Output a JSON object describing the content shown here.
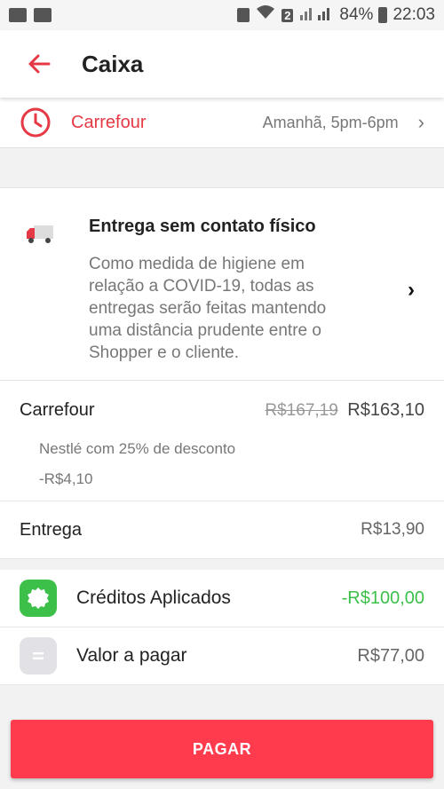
{
  "status_bar": {
    "battery": "84%",
    "time": "22:03",
    "sim_badge": "2"
  },
  "appbar": {
    "title": "Caixa"
  },
  "slot": {
    "store": "Carrefour",
    "time": "Amanhã, 5pm-6pm"
  },
  "contact": {
    "title": "Entrega sem contato físico",
    "description": "Como medida de higiene em relação a COVID-19, todas as entregas serão feitas mantendo uma distância prudente entre o Shopper e o cliente."
  },
  "store": {
    "name": "Carrefour",
    "old_price": "R$167,19",
    "new_price": "R$163,10",
    "promo": "Nestlé com 25% de desconto",
    "promo_value": "-R$4,10"
  },
  "delivery": {
    "label": "Entrega",
    "value": "R$13,90"
  },
  "summary": {
    "credits_label": "Créditos Aplicados",
    "credits_value": "-R$100,00",
    "total_label": "Valor a pagar",
    "total_value": "R$77,00"
  },
  "pay_button": "PAGAR",
  "colors": {
    "accent": "#e53945",
    "pay": "#ff3b4d",
    "green": "#3cc04a"
  }
}
